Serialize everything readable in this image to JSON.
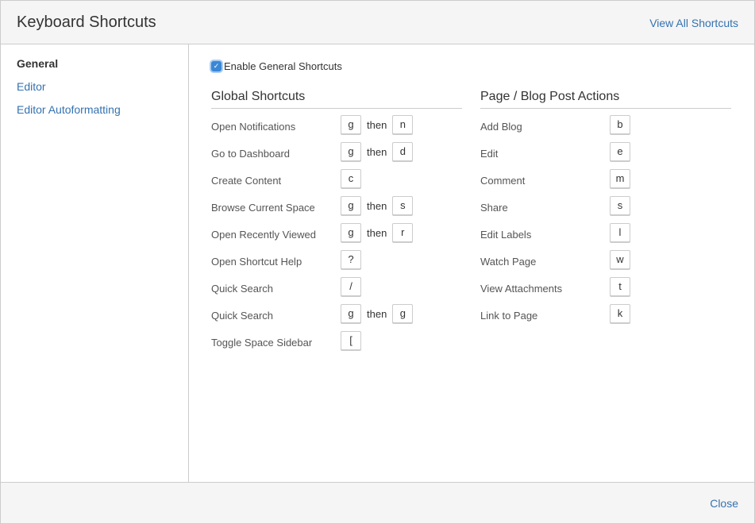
{
  "header": {
    "title": "Keyboard Shortcuts",
    "view_all_label": "View All Shortcuts"
  },
  "sidebar": {
    "items": [
      {
        "label": "General",
        "active": true
      },
      {
        "label": "Editor",
        "active": false
      },
      {
        "label": "Editor Autoformatting",
        "active": false
      }
    ]
  },
  "enable": {
    "label": "Enable General Shortcuts",
    "checked": true
  },
  "global": {
    "title": "Global Shortcuts",
    "shortcuts": [
      {
        "label": "Open Notifications",
        "keys": [
          "g",
          "n"
        ]
      },
      {
        "label": "Go to Dashboard",
        "keys": [
          "g",
          "d"
        ]
      },
      {
        "label": "Create Content",
        "keys": [
          "c"
        ]
      },
      {
        "label": "Browse Current Space",
        "keys": [
          "g",
          "s"
        ]
      },
      {
        "label": "Open Recently Viewed",
        "keys": [
          "g",
          "r"
        ]
      },
      {
        "label": "Open Shortcut Help",
        "keys": [
          "?"
        ]
      },
      {
        "label": "Quick Search",
        "keys": [
          "/"
        ]
      },
      {
        "label": "Quick Search",
        "keys": [
          "g",
          "g"
        ]
      },
      {
        "label": "Toggle Space Sidebar",
        "keys": [
          "["
        ]
      }
    ]
  },
  "page": {
    "title": "Page / Blog Post Actions",
    "shortcuts": [
      {
        "label": "Add Blog",
        "keys": [
          "b"
        ]
      },
      {
        "label": "Edit",
        "keys": [
          "e"
        ]
      },
      {
        "label": "Comment",
        "keys": [
          "m"
        ]
      },
      {
        "label": "Share",
        "keys": [
          "s"
        ]
      },
      {
        "label": "Edit Labels",
        "keys": [
          "l"
        ]
      },
      {
        "label": "Watch Page",
        "keys": [
          "w"
        ]
      },
      {
        "label": "View Attachments",
        "keys": [
          "t"
        ]
      },
      {
        "label": "Link to Page",
        "keys": [
          "k"
        ]
      }
    ]
  },
  "then_label": "then",
  "footer": {
    "close_label": "Close"
  },
  "colors": {
    "link": "#3572b0",
    "checkbox": "#3b87d6"
  }
}
